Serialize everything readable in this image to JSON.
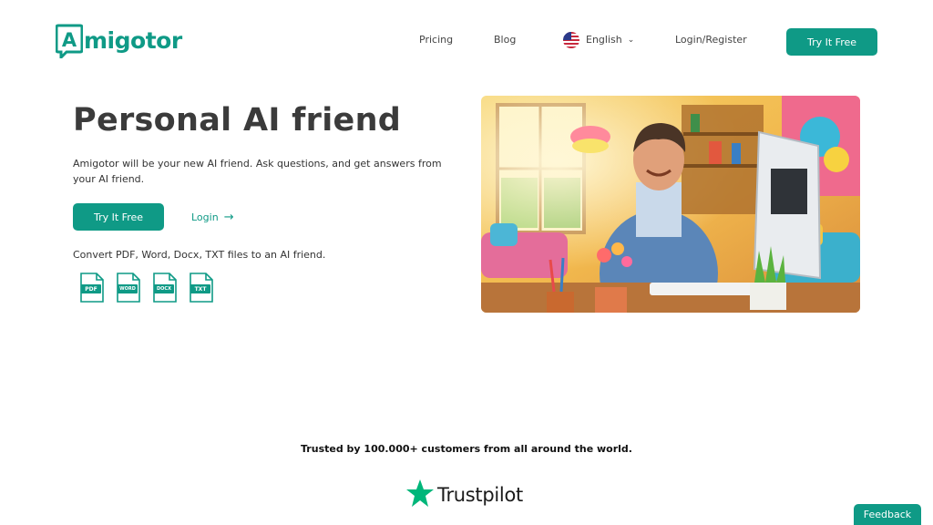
{
  "brand": {
    "name": "migotor",
    "logo_letter": "A",
    "color": "#0f9a86"
  },
  "nav": {
    "pricing": "Pricing",
    "blog": "Blog",
    "language": "English",
    "language_icon": "us-flag-icon",
    "login_register": "Login/Register",
    "cta": "Try It Free"
  },
  "hero": {
    "title": "Personal AI friend",
    "description": "Amigotor will be your new AI friend. Ask questions, and get answers from your AI friend.",
    "cta": "Try It Free",
    "login": "Login",
    "convert_text": "Convert PDF, Word, Docx, TXT files to an AI friend.",
    "file_types": [
      "PDF",
      "WORD",
      "DOCX",
      "TXT"
    ],
    "image": "smiling-man-at-computer-illustration"
  },
  "trust": {
    "headline": "Trusted by 100.000+ customers from all around the world.",
    "trustpilot": "Trustpilot"
  },
  "feedback": {
    "label": "Feedback"
  }
}
